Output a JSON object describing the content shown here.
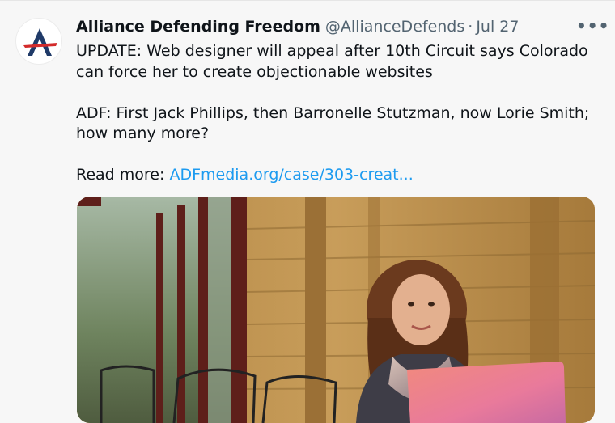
{
  "tweet": {
    "author_name": "Alliance Defending Freedom",
    "handle": "@AllianceDefends",
    "separator": "·",
    "date": "Jul 27",
    "more_label": "•••",
    "paragraphs": [
      "UPDATE: Web designer will appeal after 10th Circuit says Colorado can force her to create objectionable websites",
      "ADF: First Jack Phillips, then Barronelle Stutzman, now Lorie Smith; how many more?"
    ],
    "read_more_prefix": "Read more: ",
    "link_text": "ADFmedia.org/case/303-creat..."
  },
  "colors": {
    "background": "#f7f7f7",
    "text": "#0f1419",
    "secondary": "#536471",
    "link": "#1d9bf0",
    "logo_blue": "#1f3a68",
    "logo_red": "#d32b2b"
  },
  "icons": {
    "avatar": "adf-logo-icon",
    "more": "more-options-icon"
  }
}
